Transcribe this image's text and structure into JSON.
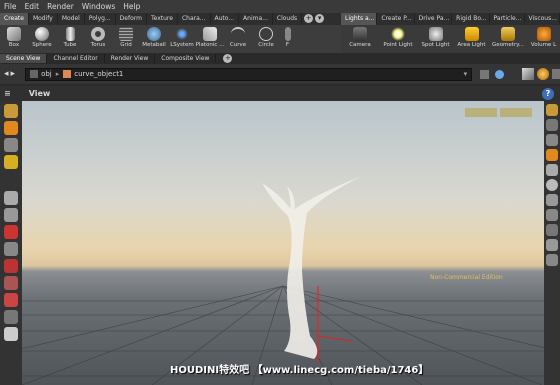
{
  "menu": [
    "File",
    "Edit",
    "Render",
    "Windows",
    "Help"
  ],
  "shelf_tabs_left": [
    "Create",
    "Modify",
    "Model",
    "Polyg...",
    "Deform",
    "Texture",
    "Chara...",
    "Auto...",
    "Anima...",
    "Clouds"
  ],
  "shelf_tabs_right": [
    "Lights a...",
    "Create P...",
    "Drive Pa...",
    "Rigid Bo...",
    "Particle...",
    "Viscous..."
  ],
  "tools_left": [
    "Box",
    "Sphere",
    "Tube",
    "Torus",
    "Grid",
    "Metaball",
    "LSystem",
    "Platonic ...",
    "Curve",
    "Circle",
    "F"
  ],
  "tools_right": [
    "Camera",
    "Point Light",
    "Spot Light",
    "Area Light",
    "Geometry...",
    "Volume L"
  ],
  "pane_tabs": [
    "Scene View",
    "Channel Editor",
    "Render View",
    "Composite View"
  ],
  "path": {
    "root": "obj",
    "node": "curve_object1"
  },
  "view_title": "View",
  "overlay": {
    "watermark": "HOUDINI特效吧 【www.linecg.com/tieba/1746】",
    "edition": "Non-Commercial Edition"
  },
  "colors": {
    "accent": "#e08a1e",
    "bg": "#2b2b2b",
    "panel": "#3a3a3a"
  }
}
